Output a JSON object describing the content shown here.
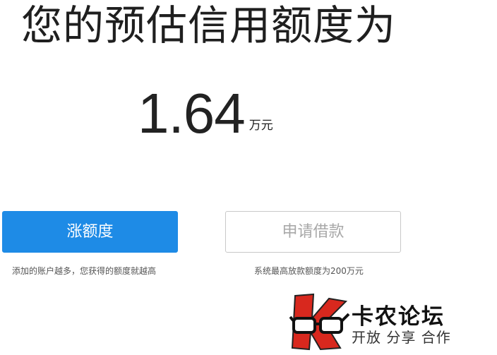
{
  "header": {
    "title": "您的预估信用额度为"
  },
  "amount": {
    "value": "1.64",
    "unit": "万元"
  },
  "actions": {
    "raise_label": "涨额度",
    "raise_hint": "添加的账户越多，您获得的额度就越高",
    "apply_label": "申请借款",
    "apply_hint": "系统最高放款额度为200万元"
  },
  "watermark": {
    "name": "卡农论坛",
    "slogan": "开放 分享 合作",
    "icon": "k-glasses-logo-icon"
  },
  "colors": {
    "primary": "#1e8be6",
    "logo_red": "#d8281e"
  }
}
